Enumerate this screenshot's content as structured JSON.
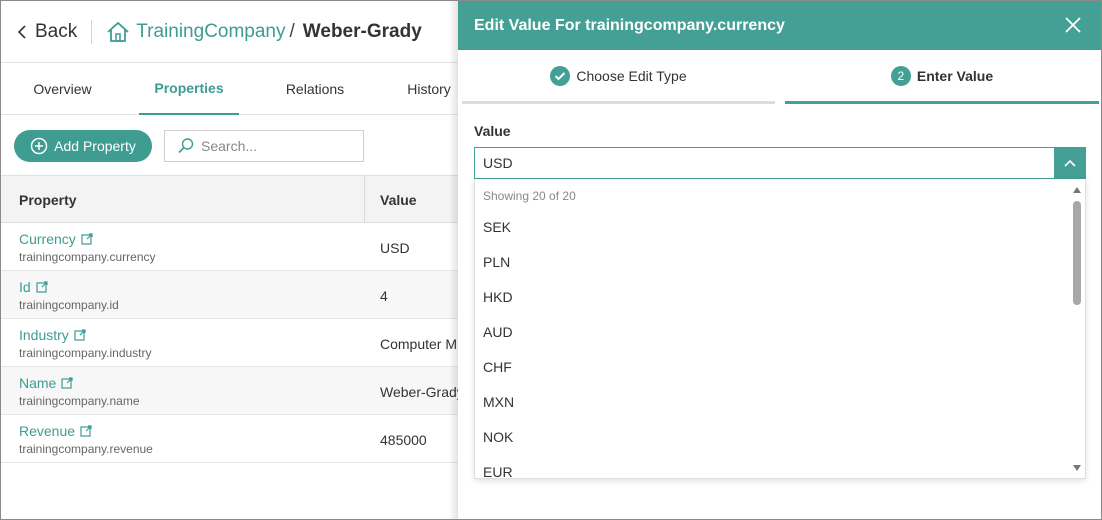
{
  "nav": {
    "back_label": "Back",
    "breadcrumb_link": "TrainingCompany",
    "breadcrumb_sep": "/",
    "breadcrumb_current": "Weber-Grady"
  },
  "tabs": [
    {
      "label": "Overview"
    },
    {
      "label": "Properties"
    },
    {
      "label": "Relations"
    },
    {
      "label": "History"
    }
  ],
  "toolbar": {
    "add_label": "Add Property",
    "search_placeholder": "Search..."
  },
  "table": {
    "headers": [
      "Property",
      "Value"
    ],
    "rows": [
      {
        "name": "Currency",
        "key": "trainingcompany.currency",
        "value": "USD"
      },
      {
        "name": "Id",
        "key": "trainingcompany.id",
        "value": "4"
      },
      {
        "name": "Industry",
        "key": "trainingcompany.industry",
        "value": "Computer M"
      },
      {
        "name": "Name",
        "key": "trainingcompany.name",
        "value": "Weber-Grady"
      },
      {
        "name": "Revenue",
        "key": "trainingcompany.revenue",
        "value": "485000"
      }
    ]
  },
  "panel": {
    "title": "Edit Value For trainingcompany.currency",
    "step1": "Choose Edit Type",
    "step2_number": "2",
    "step2": "Enter Value",
    "field_label": "Value",
    "selected_value": "USD",
    "dropdown_count": "Showing 20 of 20",
    "options": [
      "SEK",
      "PLN",
      "HKD",
      "AUD",
      "CHF",
      "MXN",
      "NOK",
      "EUR"
    ]
  },
  "colors": {
    "accent": "#44a095",
    "link": "#3e9c91"
  }
}
